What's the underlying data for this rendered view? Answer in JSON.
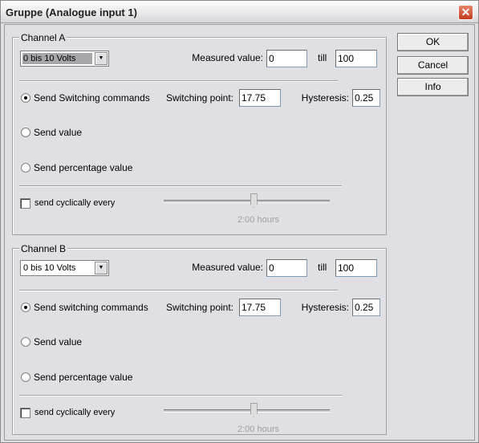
{
  "window": {
    "title": "Gruppe (Analogue input 1)",
    "close_icon": "close-icon"
  },
  "buttons": {
    "ok": "OK",
    "cancel": "Cancel",
    "info": "Info"
  },
  "channels": [
    {
      "label": "Channel A",
      "range": "0 bis 10 Volts",
      "measured_label": "Measured value:",
      "measured_from": "0",
      "till_label": "till",
      "measured_to": "100",
      "options": [
        "Send Switching commands",
        "Send value",
        "Send percentage value"
      ],
      "selected_option": 0,
      "switching_point_label": "Switching point:",
      "switching_point": "17.75",
      "hysteresis_label": "Hysteresis:",
      "hysteresis": "0.25",
      "cyclic_label": "send cyclically every",
      "cyclic_checked": false,
      "cyclic_value": "2:00 hours",
      "slider_fraction": 0.54
    },
    {
      "label": "Channel B",
      "range": "0 bis 10 Volts",
      "measured_label": "Measured value:",
      "measured_from": "0",
      "till_label": "till",
      "measured_to": "100",
      "options": [
        "Send switching commands",
        "Send value",
        "Send percentage value"
      ],
      "selected_option": 0,
      "switching_point_label": "Switching point:",
      "switching_point": "17.75",
      "hysteresis_label": "Hysteresis:",
      "hysteresis": "0.25",
      "cyclic_label": "send cyclically every",
      "cyclic_checked": false,
      "cyclic_value": "2:00 hours",
      "slider_fraction": 0.54
    }
  ]
}
